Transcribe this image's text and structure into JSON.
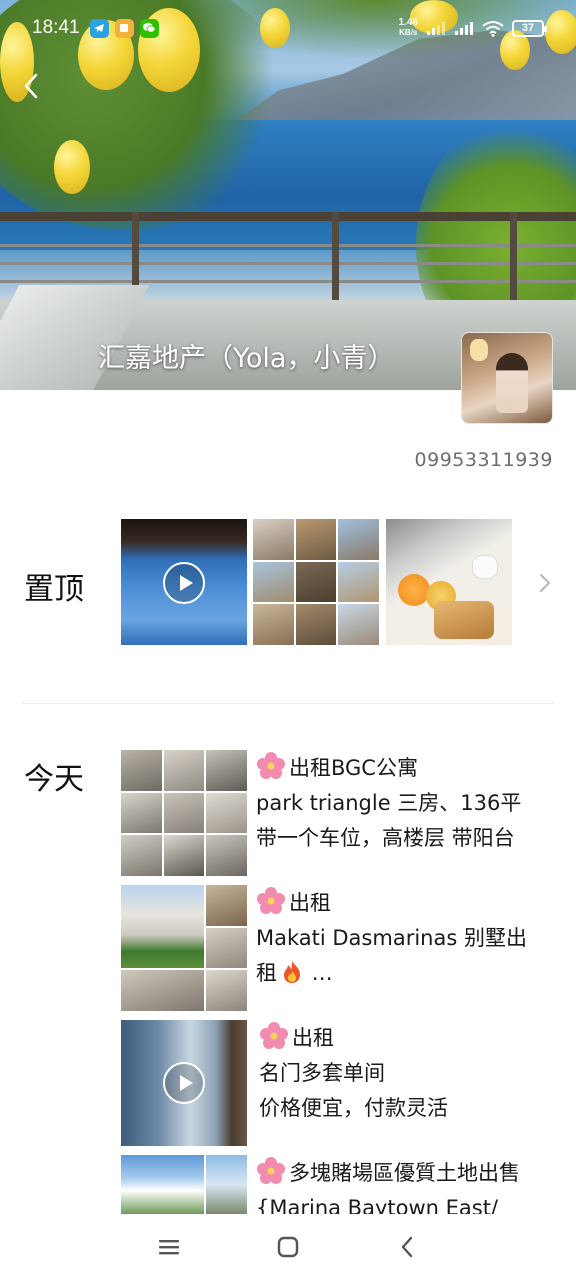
{
  "status_bar": {
    "time": "18:41",
    "net_speed_value": "1.46",
    "net_speed_unit": "KB/s",
    "battery": "37"
  },
  "profile": {
    "name": "汇嘉地产（Yola，小青）",
    "phone": "09953311939"
  },
  "pinned": {
    "label": "置顶"
  },
  "today": {
    "label": "今天",
    "posts": [
      {
        "lines": [
          "出租BGC公寓",
          "park triangle 三房、136平",
          "带一个车位，高楼层 带阳台"
        ]
      },
      {
        "lines": [
          "出租",
          "Makati Dasmarinas 别墅出",
          "租"
        ],
        "tail": " …"
      },
      {
        "lines": [
          "出租",
          "名门多套单间",
          "价格便宜，付款灵活"
        ]
      },
      {
        "lines": [
          "多塊賭場區優質土地出售",
          "{Marina Baytown East/"
        ]
      }
    ]
  },
  "icons": {
    "back": "chevron-left-icon",
    "more": "chevron-right-icon",
    "flower": "cherry-blossom-icon",
    "fire": "fire-icon",
    "play": "play-icon",
    "nav_menu": "menu-icon",
    "nav_home": "home-icon",
    "nav_back": "back-icon"
  },
  "colors": {
    "accent_flower": "#f28bb0",
    "meta_text": "#6d6d6d"
  }
}
